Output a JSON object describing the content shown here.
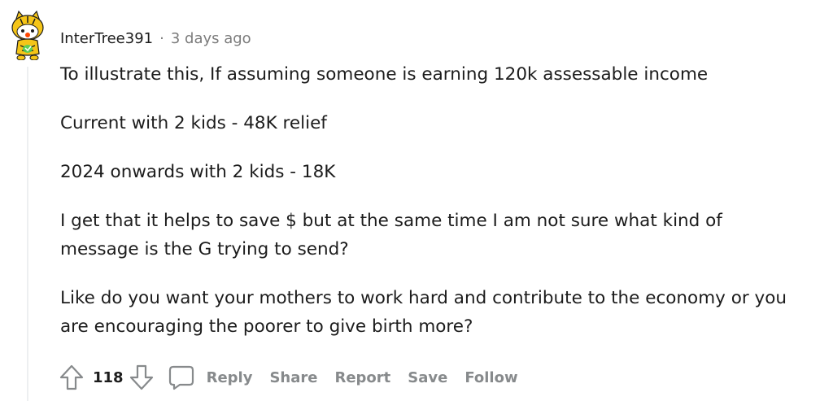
{
  "comment": {
    "username": "InterTree391",
    "separator": "·",
    "timestamp": "3 days ago",
    "paragraphs": [
      "To illustrate this, If assuming someone is earning 120k assessable income",
      "Current with 2 kids - 48K relief",
      "2024 onwards with 2 kids - 18K",
      "I get that it helps to save $ but at the same time I am not sure what kind of message is the G trying to send?",
      "Like do you want your mothers to work hard and contribute to the economy or you are encouraging the poorer to give birth more?"
    ]
  },
  "actions": {
    "score": "118",
    "reply_label": "Reply",
    "share_label": "Share",
    "report_label": "Report",
    "save_label": "Save",
    "follow_label": "Follow"
  },
  "icons": {
    "avatar": "snoo-tiger-avatar",
    "upvote": "upvote-arrow-icon",
    "downvote": "downvote-arrow-icon",
    "reply": "speech-bubble-icon"
  },
  "colors": {
    "text": "#1c1c1c",
    "muted": "#7c7c7c",
    "action": "#878a8c",
    "thread_line": "#edeff1",
    "avatar_yellow": "#f5c518",
    "avatar_red": "#ff4500"
  }
}
